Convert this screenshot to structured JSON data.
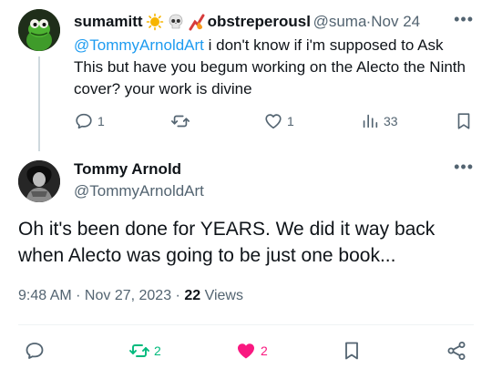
{
  "reply": {
    "name": "sumamitt",
    "name_suffix": "obstreperously",
    "handle": "@sumamitt",
    "separator": " · ",
    "time": "Nov 24",
    "mention": "@TommyArnoldArt",
    "text": " i don't know if i'm supposed to Ask This but have you begum working on the Alecto the Ninth cover? your work is divine",
    "emojis": [
      "sun-emoji",
      "skull-emoji",
      "fire-bolt-emoji"
    ],
    "actions": {
      "replies": "1",
      "retweets": "",
      "likes": "1",
      "views": "33"
    }
  },
  "tweet": {
    "name": "Tommy Arnold",
    "handle": "@TommyArnoldArt",
    "text": "Oh it's been done for YEARS. We did it way back when Alecto was going to be just one book...",
    "time": "9:48 AM · Nov 27, 2023",
    "separator": " · ",
    "views_count": "22",
    "views_label": " Views",
    "actions": {
      "retweets": "2",
      "likes": "2"
    }
  },
  "colors": {
    "accent": "#1d9bf0",
    "retweet_active": "#00ba7c",
    "like_active": "#f91880",
    "muted": "#536471"
  }
}
